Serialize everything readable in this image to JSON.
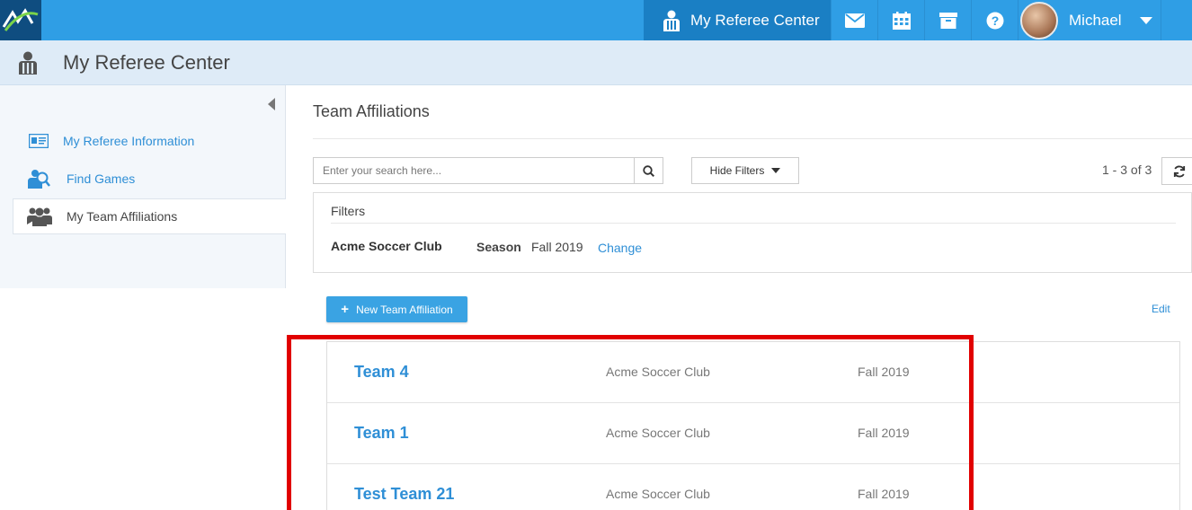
{
  "topnav": {
    "app_label": "My Referee Center",
    "user_name": "Michael",
    "icons": [
      "mail-icon",
      "calendar-icon",
      "archive-icon",
      "help-icon"
    ],
    "bg_color": "#2f9ee5",
    "active_color": "#1a7fc4"
  },
  "subheader": {
    "title": "My Referee Center"
  },
  "sidebar": {
    "items": [
      {
        "label": "My Referee Information",
        "icon": "id-card-icon"
      },
      {
        "label": "Find Games",
        "icon": "search-person-icon"
      },
      {
        "label": "My Team Affiliations",
        "icon": "group-icon",
        "active": true
      }
    ]
  },
  "main": {
    "title": "Team Affiliations",
    "search_placeholder": "Enter your search here...",
    "hide_filters_label": "Hide Filters",
    "pager": "1 - 3 of 3",
    "filters": {
      "heading": "Filters",
      "club": "Acme Soccer Club",
      "season_label": "Season",
      "season_value": "Fall 2019",
      "change_label": "Change"
    },
    "new_button_label": "New Team Affiliation",
    "edit_label": "Edit",
    "rows": [
      {
        "name": "Team 4",
        "club": "Acme Soccer Club",
        "season": "Fall 2019"
      },
      {
        "name": "Team 1",
        "club": "Acme Soccer Club",
        "season": "Fall 2019"
      },
      {
        "name": "Test Team 21",
        "club": "Acme Soccer Club",
        "season": "Fall 2019"
      }
    ]
  },
  "highlight_color": "#e10000"
}
